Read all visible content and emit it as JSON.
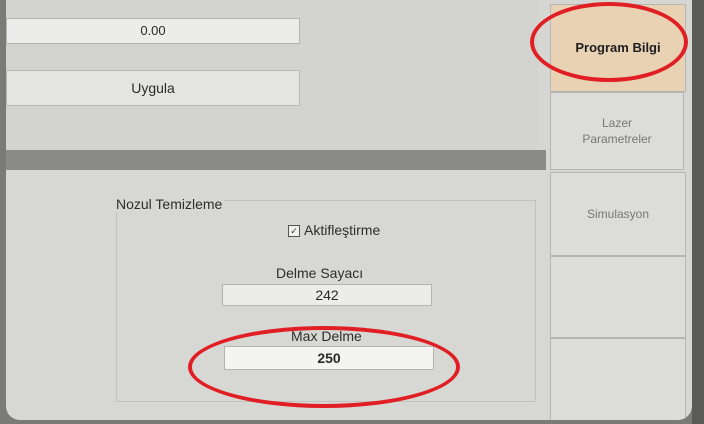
{
  "top_panel": {
    "value_field": "0.00",
    "apply_button": "Uygula"
  },
  "nozzle_cleaning": {
    "title": "Nozul Temizleme",
    "activate_label": "Aktifleştirme",
    "activate_checked": true,
    "drill_counter_label": "Delme Sayacı",
    "drill_counter_value": "242",
    "max_drill_label": "Max Delme",
    "max_drill_value": "250"
  },
  "side_menu": {
    "items": [
      {
        "label": "Program Bilgi",
        "active": true
      },
      {
        "label": "Lazer Parametreler",
        "active": false
      },
      {
        "label": "Simulasyon",
        "active": false
      },
      {
        "label": "",
        "active": false
      },
      {
        "label": "",
        "active": false
      }
    ]
  },
  "annotation_color": "#e01e24"
}
